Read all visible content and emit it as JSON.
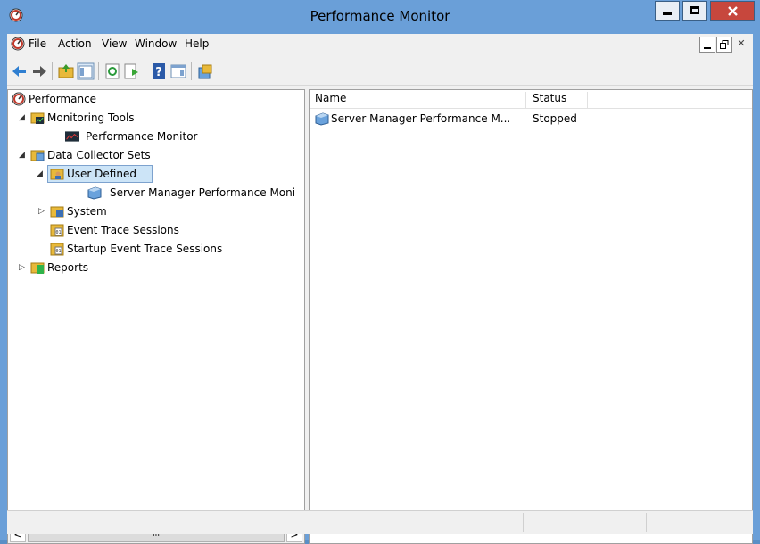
{
  "window": {
    "title": "Performance Monitor",
    "colors": {
      "frame": "#6a9fd8",
      "close": "#c7473d",
      "selection": "#cce4f7"
    }
  },
  "menu": {
    "items": [
      "File",
      "Action",
      "View",
      "Window",
      "Help"
    ]
  },
  "toolbar": {
    "icons": [
      "back-icon",
      "forward-icon",
      "up-folder-icon",
      "show-hide-console-tree-icon",
      "refresh-icon",
      "export-list-icon",
      "help-icon",
      "properties-icon",
      "new-icon"
    ]
  },
  "tree": {
    "root": "Performance",
    "monitoring_tools": "Monitoring Tools",
    "performance_monitor": "Performance Monitor",
    "data_collector_sets": "Data Collector Sets",
    "user_defined": "User Defined",
    "server_manager": "Server Manager Performance Moni",
    "system": "System",
    "event_trace": "Event Trace Sessions",
    "startup_event_trace": "Startup Event Trace Sessions",
    "reports": "Reports",
    "scroll_thumb": "III"
  },
  "list": {
    "columns": [
      "Name",
      "Status"
    ],
    "rows": [
      {
        "name": "Server Manager Performance M...",
        "status": "Stopped"
      }
    ]
  }
}
